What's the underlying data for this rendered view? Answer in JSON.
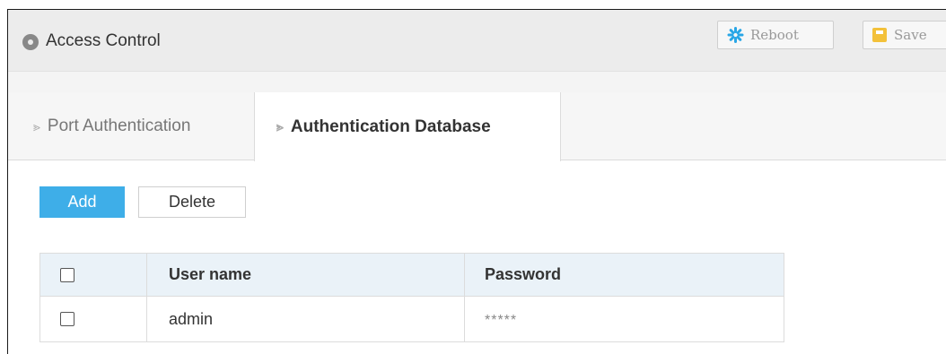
{
  "header": {
    "title": "Access Control",
    "reboot_label": "Reboot",
    "save_label": "Save"
  },
  "tabs": [
    {
      "label": "Port Authentication",
      "active": false
    },
    {
      "label": "Authentication Database",
      "active": true
    }
  ],
  "actions": {
    "add_label": "Add",
    "delete_label": "Delete"
  },
  "table": {
    "columns": [
      "User name",
      "Password"
    ],
    "rows": [
      {
        "user": "admin",
        "password": "*****"
      }
    ]
  },
  "colors": {
    "accent": "#3eaee8",
    "header_bg": "#ececec",
    "table_header_bg": "#eaf2f8",
    "save_icon": "#f3c13a"
  }
}
